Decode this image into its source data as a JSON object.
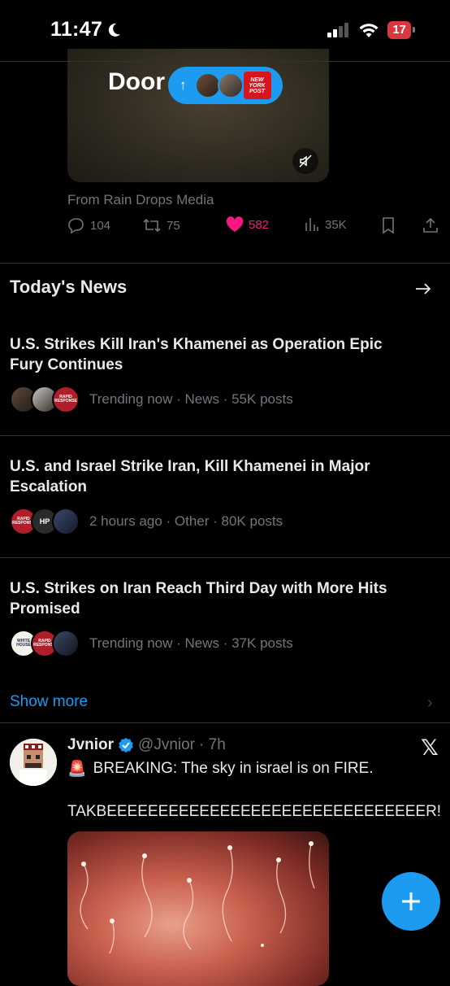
{
  "status_bar": {
    "time": "11:47",
    "battery": "17"
  },
  "media_post": {
    "overlay_text": "Door",
    "pill_badge": "NEW YORK POST",
    "source": "From Rain Drops Media",
    "actions": {
      "replies": "104",
      "reposts": "75",
      "likes": "582",
      "views": "35K"
    },
    "like_color": "#f91880"
  },
  "todays_news": {
    "header": "Today's News",
    "items": [
      {
        "title": "U.S. Strikes Kill Iran's Khamenei as Operation Epic Fury Continues",
        "meta": "Trending now · News · 55K posts",
        "badges": [
          "RAPID RESPONSE"
        ]
      },
      {
        "title": "U.S. and Israel Strike Iran, Kill Khamenei in Major Escalation",
        "meta": "2 hours ago · Other · 80K posts",
        "badges": [
          "RAPID RESPONSE",
          "HP"
        ]
      },
      {
        "title": "U.S. Strikes on Iran Reach Third Day with More Hits Promised",
        "meta": "Trending now · News · 37K posts",
        "badges": [
          "WHITE HOUSE",
          "RAPID RESPONSE"
        ]
      }
    ],
    "show_more": "Show more"
  },
  "tweet": {
    "name": "Jvnior",
    "handle": "@Jvnior",
    "time": "· 7h",
    "emoji": "🚨",
    "text": "BREAKING: The sky in israel is on FIRE.",
    "text2": "TAKBEEEEEEEEEEEEEEEEEEEEEEEEEEEEEEER!",
    "x_logo": "𝕏"
  },
  "colors": {
    "accent": "#1d9bf0",
    "muted": "#71767b",
    "like": "#f91880",
    "battery": "#d9363e"
  }
}
